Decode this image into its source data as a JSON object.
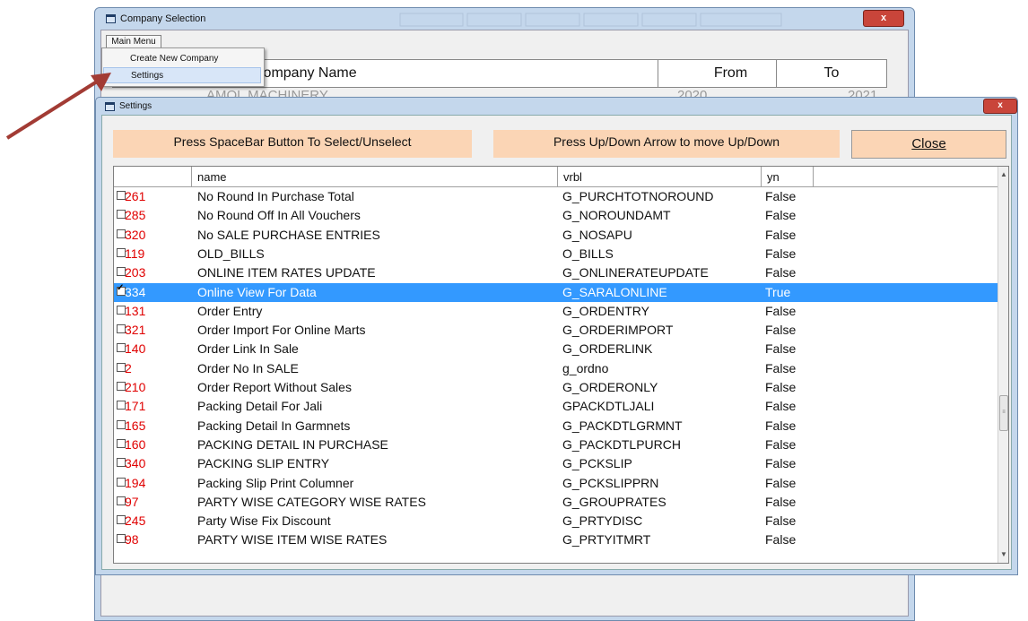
{
  "company_window": {
    "title": "Company Selection",
    "close": "x",
    "main_menu_label": "Main Menu",
    "columns": {
      "company_name": "Company Name",
      "from": "From",
      "to": "To"
    },
    "visible_row": {
      "name": "AMOL MACHINERY",
      "from": "2020",
      "to": "2021"
    }
  },
  "main_menu": {
    "items": [
      {
        "label": "Create New Company"
      },
      {
        "label": "Settings"
      }
    ]
  },
  "settings_window": {
    "title": "Settings",
    "close": "x",
    "hint_select": "Press SpaceBar Button To Select/Unselect",
    "hint_move": "Press Up/Down Arrow to move Up/Down",
    "close_button_label": "Close",
    "columns": {
      "name": "name",
      "vrbl": "vrbl",
      "yn": "yn"
    },
    "rows": [
      {
        "code": "261",
        "name": "No Round In Purchase Total",
        "vrbl": "G_PURCHTOTNOROUND",
        "yn": "False",
        "checked": false
      },
      {
        "code": "285",
        "name": "No Round Off In All Vouchers",
        "vrbl": "G_NOROUNDAMT",
        "yn": "False",
        "checked": false
      },
      {
        "code": "320",
        "name": "No SALE PURCHASE ENTRIES",
        "vrbl": "G_NOSAPU",
        "yn": "False",
        "checked": false
      },
      {
        "code": "119",
        "name": "OLD_BILLS",
        "vrbl": "O_BILLS",
        "yn": "False",
        "checked": false
      },
      {
        "code": "203",
        "name": "ONLINE ITEM RATES UPDATE",
        "vrbl": "G_ONLINERATEUPDATE",
        "yn": "False",
        "checked": false
      },
      {
        "code": "334",
        "name": "Online View For Data",
        "vrbl": "G_SARALONLINE",
        "yn": "True",
        "checked": true,
        "selected": true
      },
      {
        "code": "131",
        "name": "Order Entry",
        "vrbl": "G_ORDENTRY",
        "yn": "False",
        "checked": false
      },
      {
        "code": "321",
        "name": "Order Import For Online Marts",
        "vrbl": "G_ORDERIMPORT",
        "yn": "False",
        "checked": false
      },
      {
        "code": "140",
        "name": "Order Link In Sale",
        "vrbl": "G_ORDERLINK",
        "yn": "False",
        "checked": false
      },
      {
        "code": "2",
        "name": "Order No In SALE",
        "vrbl": "g_ordno",
        "yn": "False",
        "checked": false
      },
      {
        "code": "210",
        "name": "Order Report Without Sales",
        "vrbl": "G_ORDERONLY",
        "yn": "False",
        "checked": false
      },
      {
        "code": "171",
        "name": "Packing Detail For Jali",
        "vrbl": "GPACKDTLJALI",
        "yn": "False",
        "checked": false
      },
      {
        "code": "165",
        "name": "Packing Detail In Garmnets",
        "vrbl": "G_PACKDTLGRMNT",
        "yn": "False",
        "checked": false
      },
      {
        "code": "160",
        "name": "PACKING DETAIL IN PURCHASE",
        "vrbl": "G_PACKDTLPURCH",
        "yn": "False",
        "checked": false
      },
      {
        "code": "340",
        "name": "PACKING SLIP ENTRY",
        "vrbl": "G_PCKSLIP",
        "yn": "False",
        "checked": false
      },
      {
        "code": "194",
        "name": "Packing Slip Print Columner",
        "vrbl": "G_PCKSLIPPRN",
        "yn": "False",
        "checked": false
      },
      {
        "code": "97",
        "name": "PARTY WISE CATEGORY WISE RATES",
        "vrbl": "G_GROUPRATES",
        "yn": "False",
        "checked": false
      },
      {
        "code": "245",
        "name": "Party Wise Fix Discount",
        "vrbl": "G_PRTYDISC",
        "yn": "False",
        "checked": false
      },
      {
        "code": "98",
        "name": "PARTY WISE ITEM WISE RATES",
        "vrbl": "G_PRTYITMRT",
        "yn": "False",
        "checked": false
      }
    ]
  },
  "colors": {
    "code_text": "#e00000",
    "selection": "#3399ff",
    "hint_background": "#fbd5b5",
    "annotation_arrow": "#a23b34"
  }
}
